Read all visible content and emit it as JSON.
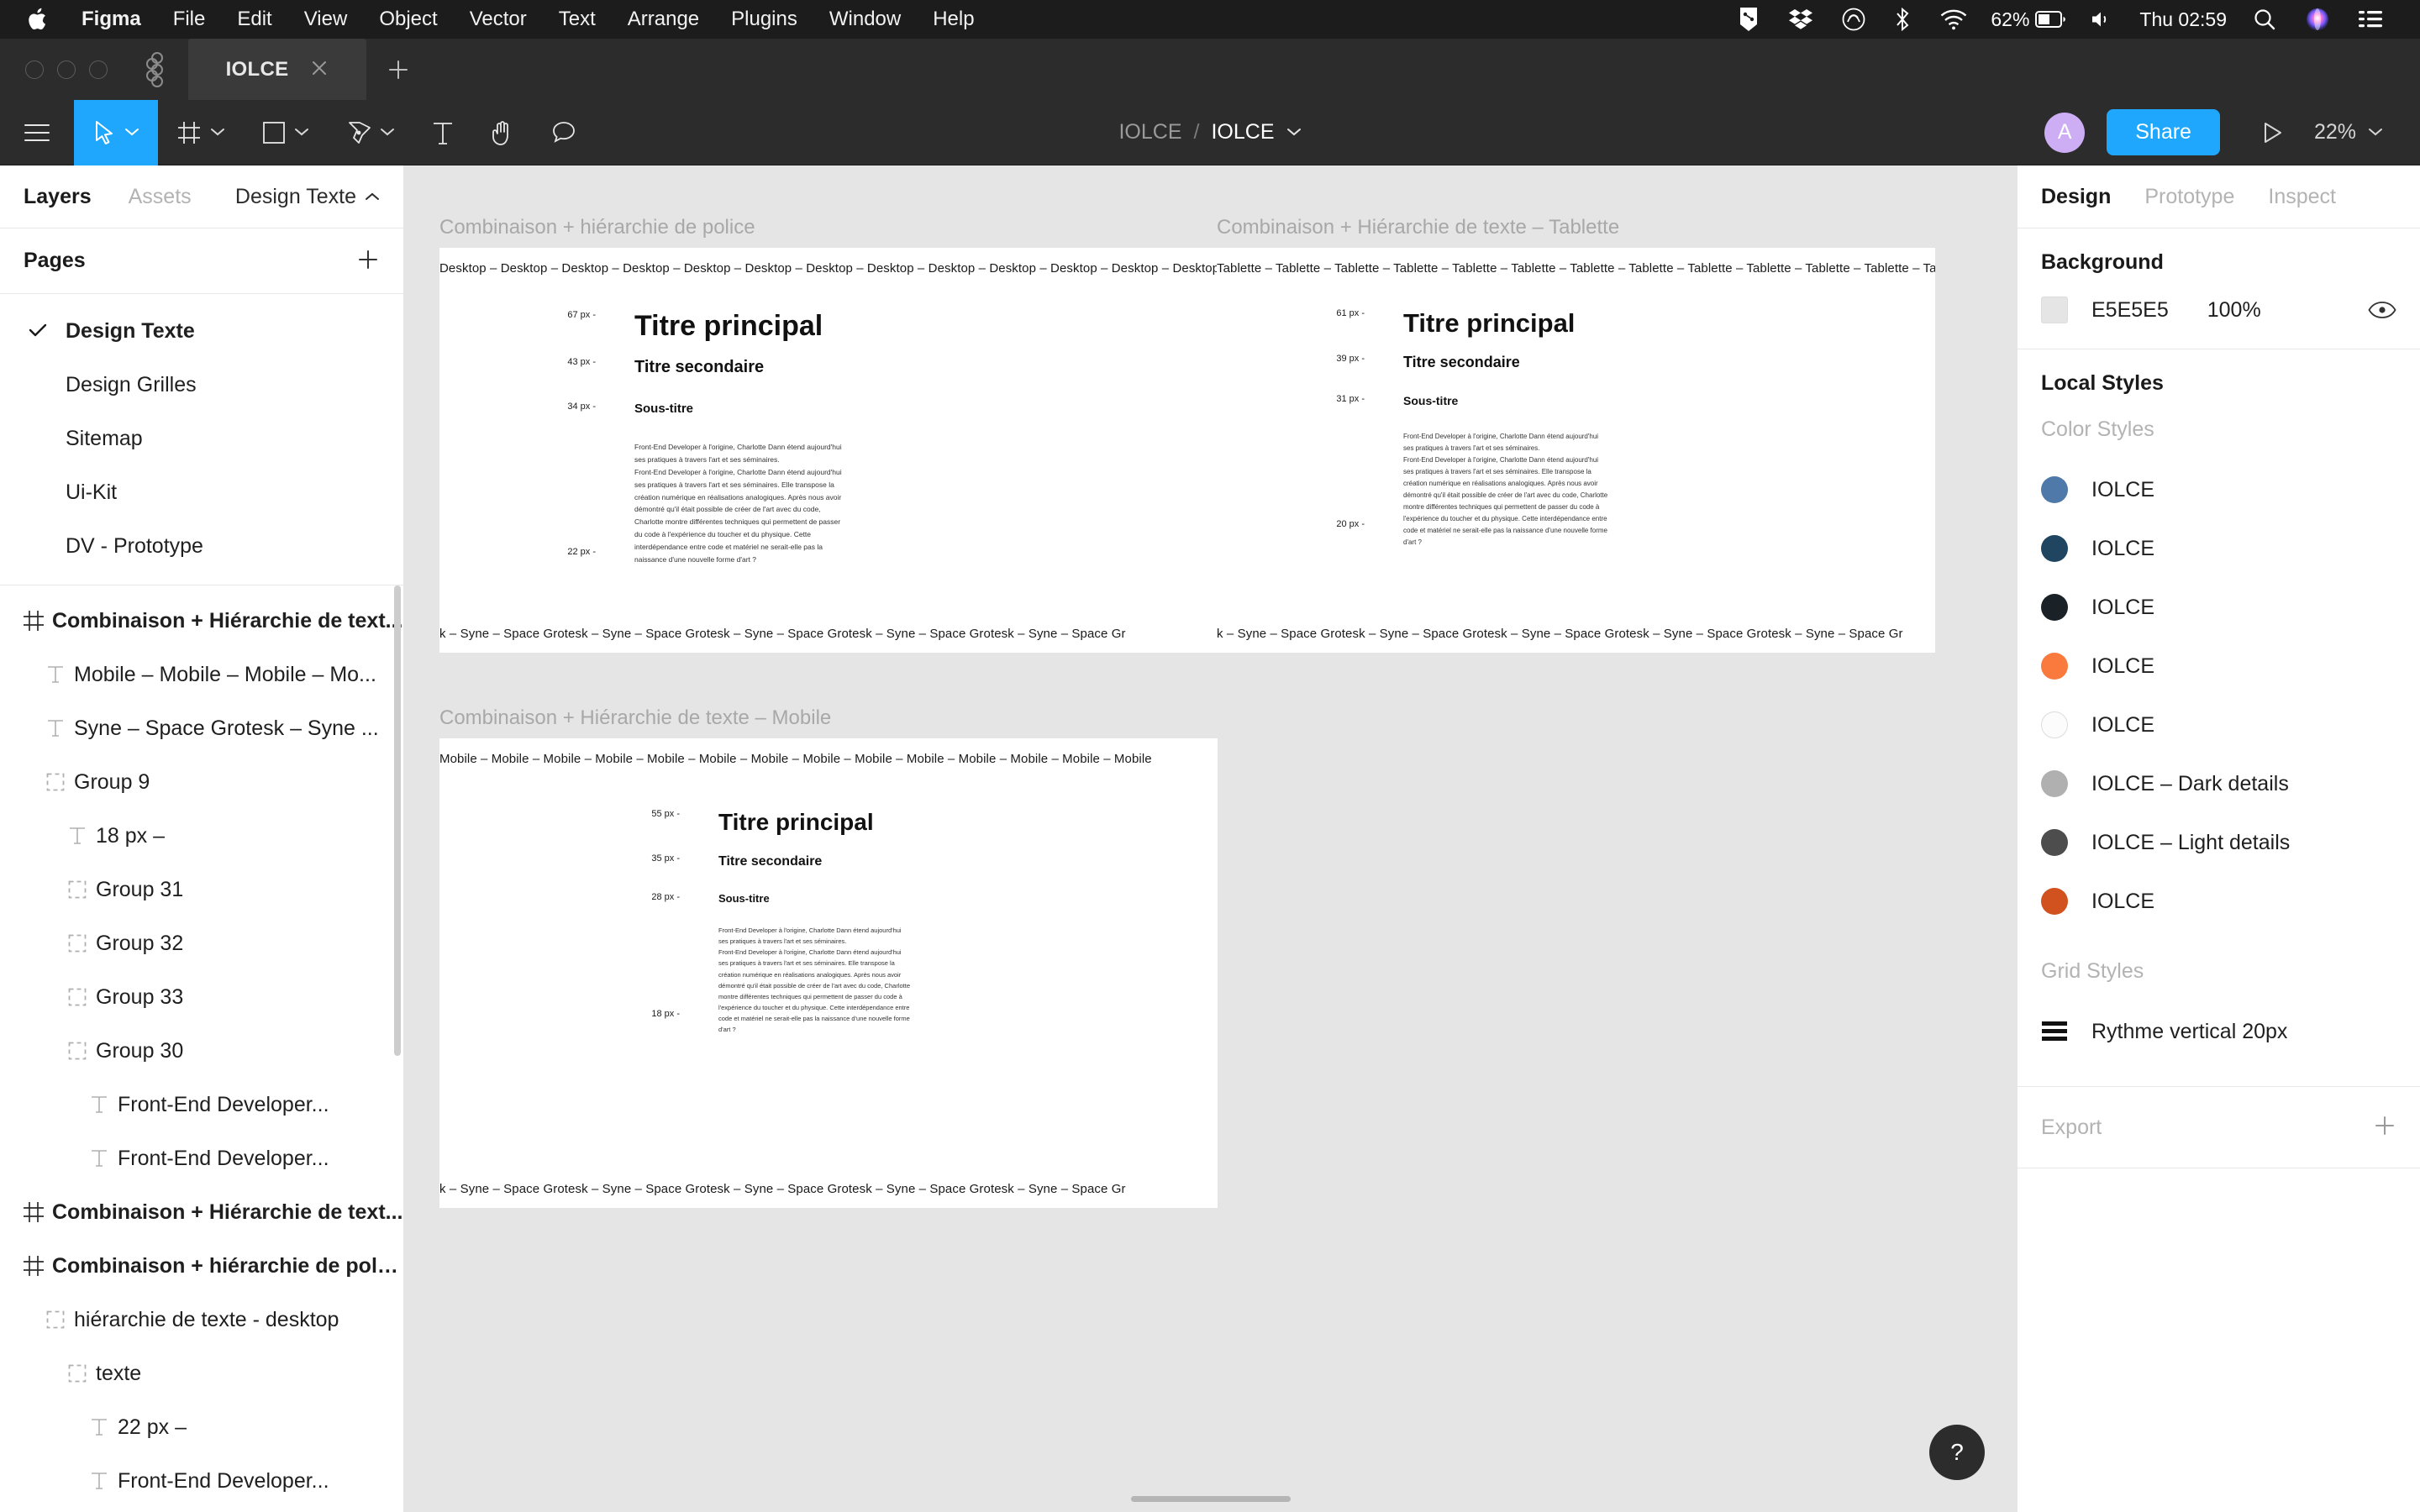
{
  "menubar": {
    "apple_icon": "apple-icon",
    "items": [
      "Figma",
      "File",
      "Edit",
      "View",
      "Object",
      "Vector",
      "Text",
      "Arrange",
      "Plugins",
      "Window",
      "Help"
    ],
    "status_icons": [
      "figma-status-icon",
      "dropbox-icon",
      "creative-cloud-icon",
      "bluetooth-icon",
      "wifi-icon"
    ],
    "battery_percent": "62%",
    "volume_icon": "volume-icon",
    "clock": "Thu 02:59",
    "search_icon": "spotlight-search-icon",
    "siri_icon": "siri-icon",
    "control_center_icon": "control-center-icon"
  },
  "tabbar": {
    "figma_logo": "figma-logo-icon",
    "tab_label": "IOLCE",
    "close_icon": "close-icon",
    "new_tab_icon": "plus-icon"
  },
  "toolbar": {
    "menu_icon": "hamburger-menu-icon",
    "tools": [
      {
        "name": "move-tool",
        "icon": "cursor-icon",
        "active": true,
        "has_chevron": true
      },
      {
        "name": "frame-tool",
        "icon": "frame-icon",
        "active": false,
        "has_chevron": true
      },
      {
        "name": "shape-tool",
        "icon": "rectangle-icon",
        "active": false,
        "has_chevron": true
      },
      {
        "name": "pen-tool",
        "icon": "pen-icon",
        "active": false,
        "has_chevron": true
      },
      {
        "name": "text-tool",
        "icon": "text-icon",
        "active": false,
        "has_chevron": false
      },
      {
        "name": "hand-tool",
        "icon": "hand-icon",
        "active": false,
        "has_chevron": false
      },
      {
        "name": "comment-tool",
        "icon": "comment-icon",
        "active": false,
        "has_chevron": false
      }
    ],
    "breadcrumb_parent": "IOLCE",
    "breadcrumb_separator": "/",
    "breadcrumb_current": "IOLCE",
    "avatar_initial": "A",
    "share_label": "Share",
    "present_icon": "play-icon",
    "zoom_level": "22%"
  },
  "left_panel": {
    "tabs": [
      {
        "label": "Layers",
        "active": true
      },
      {
        "label": "Assets",
        "active": false
      }
    ],
    "page_selector": "Design Texte",
    "pages_title": "Pages",
    "add_page_icon": "plus-icon",
    "pages": [
      {
        "label": "Design Texte",
        "selected": true
      },
      {
        "label": "Design Grilles",
        "selected": false
      },
      {
        "label": "Sitemap",
        "selected": false
      },
      {
        "label": "Ui-Kit",
        "selected": false
      },
      {
        "label": "DV - Prototype",
        "selected": false
      }
    ],
    "layers": [
      {
        "label": "Combinaison + Hiérarchie de text...",
        "icon": "frame-icon",
        "indent": 0,
        "bold": true
      },
      {
        "label": "Mobile – Mobile – Mobile – Mo...",
        "icon": "text-icon",
        "indent": 1,
        "bold": false
      },
      {
        "label": "Syne – Space Grotesk – Syne ...",
        "icon": "text-icon",
        "indent": 1,
        "bold": false
      },
      {
        "label": "Group 9",
        "icon": "group-icon",
        "indent": 1,
        "bold": false
      },
      {
        "label": "18 px –",
        "icon": "text-icon",
        "indent": 2,
        "bold": false
      },
      {
        "label": "Group 31",
        "icon": "group-icon",
        "indent": 2,
        "bold": false
      },
      {
        "label": "Group 32",
        "icon": "group-icon",
        "indent": 2,
        "bold": false
      },
      {
        "label": "Group 33",
        "icon": "group-icon",
        "indent": 2,
        "bold": false
      },
      {
        "label": "Group 30",
        "icon": "group-icon",
        "indent": 2,
        "bold": false
      },
      {
        "label": "Front-End Developer...",
        "icon": "text-icon",
        "indent": 3,
        "bold": false
      },
      {
        "label": "Front-End Developer...",
        "icon": "text-icon",
        "indent": 3,
        "bold": false
      },
      {
        "label": "Combinaison + Hiérarchie de text...",
        "icon": "frame-icon",
        "indent": 0,
        "bold": true
      },
      {
        "label": "Combinaison + hiérarchie de police",
        "icon": "frame-icon",
        "indent": 0,
        "bold": true
      },
      {
        "label": "hiérarchie de texte - desktop",
        "icon": "group-icon",
        "indent": 1,
        "bold": false
      },
      {
        "label": "texte",
        "icon": "group-icon",
        "indent": 2,
        "bold": false
      },
      {
        "label": "22 px –",
        "icon": "text-icon",
        "indent": 3,
        "bold": false
      },
      {
        "label": "Front-End Developer...",
        "icon": "text-icon",
        "indent": 3,
        "bold": false
      }
    ]
  },
  "right_panel": {
    "tabs": [
      {
        "label": "Design",
        "active": true
      },
      {
        "label": "Prototype",
        "active": false
      },
      {
        "label": "Inspect",
        "active": false
      }
    ],
    "background": {
      "title": "Background",
      "hex": "E5E5E5",
      "swatch_color": "#E5E5E5",
      "opacity": "100%",
      "visibility_icon": "eye-icon"
    },
    "local_styles": {
      "title": "Local Styles",
      "color_styles_label": "Color Styles",
      "color_styles": [
        {
          "name": "IOLCE",
          "color": "#4f79a8"
        },
        {
          "name": "IOLCE",
          "color": "#1f4561"
        },
        {
          "name": "IOLCE",
          "color": "#1b2227"
        },
        {
          "name": "IOLCE",
          "color": "#f97a3c"
        },
        {
          "name": "IOLCE",
          "color": "#fcfcfc"
        },
        {
          "name": "IOLCE – Dark details",
          "color": "#b0b0b0"
        },
        {
          "name": "IOLCE – Light details",
          "color": "#4d4d4d"
        },
        {
          "name": "IOLCE",
          "color": "#d1521f"
        }
      ],
      "grid_styles_label": "Grid Styles",
      "grid_styles": [
        {
          "name": "Rythme vertical 20px",
          "icon": "grid-rows-icon"
        }
      ]
    },
    "export": {
      "title": "Export",
      "add_icon": "plus-icon"
    }
  },
  "canvas": {
    "help_icon": "?",
    "body_short": "Front-End Developer à l'origine, Charlotte Dann étend aujourd'hui ses pratiques à travers l'art et ses séminaires.",
    "body_long": "Front-End Developer à l'origine, Charlotte Dann étend aujourd'hui ses pratiques à travers l'art et ses séminaires. Elle transpose la création numérique en réalisations analogiques. Après nous avoir démontré qu'il était possible de créer de l'art avec du code, Charlotte montre différentes techniques qui permettent de passer du code à l'expérience du toucher et du physique. Cette interdépendance entre code et matériel ne serait-elle pas la naissance d'une nouvelle forme d'art ?",
    "frames": [
      {
        "title": "Combinaison + hiérarchie de police",
        "ticker_top": "Desktop – Desktop – Desktop – Desktop – Desktop – Desktop – Desktop – Desktop – Desktop – Desktop – Desktop – Desktop – Desktop – Desktop",
        "ticker_bottom": "esk – Syne – Space Grotesk – Syne – Space Grotesk – Syne – Space Grotesk – Syne – Space Grotesk – Syne – Space Gr",
        "specs": [
          {
            "label": "67 px -",
            "text": "Titre principal",
            "role": "h1"
          },
          {
            "label": "43 px -",
            "text": "Titre secondaire",
            "role": "h2"
          },
          {
            "label": "34 px -",
            "text": "Sous-titre",
            "role": "h3"
          },
          {
            "label": "22 px -",
            "role": "body"
          }
        ]
      },
      {
        "title": "Combinaison + Hiérarchie de texte – Tablette",
        "ticker_top": "Tablette – Tablette – Tablette – Tablette – Tablette – Tablette – Tablette – Tablette – Tablette – Tablette – Tablette – Tablette – Tablette – Tablette",
        "ticker_bottom": "esk – Syne – Space Grotesk – Syne – Space Grotesk – Syne – Space Grotesk – Syne – Space Grotesk – Syne – Space Gr",
        "specs": [
          {
            "label": "61 px -",
            "text": "Titre principal",
            "role": "h1"
          },
          {
            "label": "39 px -",
            "text": "Titre secondaire",
            "role": "h2"
          },
          {
            "label": "31 px -",
            "text": "Sous-titre",
            "role": "h3"
          },
          {
            "label": "20 px -",
            "role": "body"
          }
        ]
      },
      {
        "title": "Combinaison + Hiérarchie de texte – Mobile",
        "ticker_top": "Mobile – Mobile – Mobile – Mobile – Mobile – Mobile – Mobile – Mobile – Mobile – Mobile – Mobile – Mobile – Mobile – Mobile",
        "ticker_bottom": "esk – Syne – Space Grotesk – Syne – Space Grotesk – Syne – Space Grotesk – Syne – Space Grotesk – Syne – Space Gr",
        "specs": [
          {
            "label": "55 px -",
            "text": "Titre principal",
            "role": "h1"
          },
          {
            "label": "35 px -",
            "text": "Titre secondaire",
            "role": "h2"
          },
          {
            "label": "28 px -",
            "text": "Sous-titre",
            "role": "h3"
          },
          {
            "label": "18 px -",
            "role": "body"
          }
        ]
      }
    ]
  }
}
